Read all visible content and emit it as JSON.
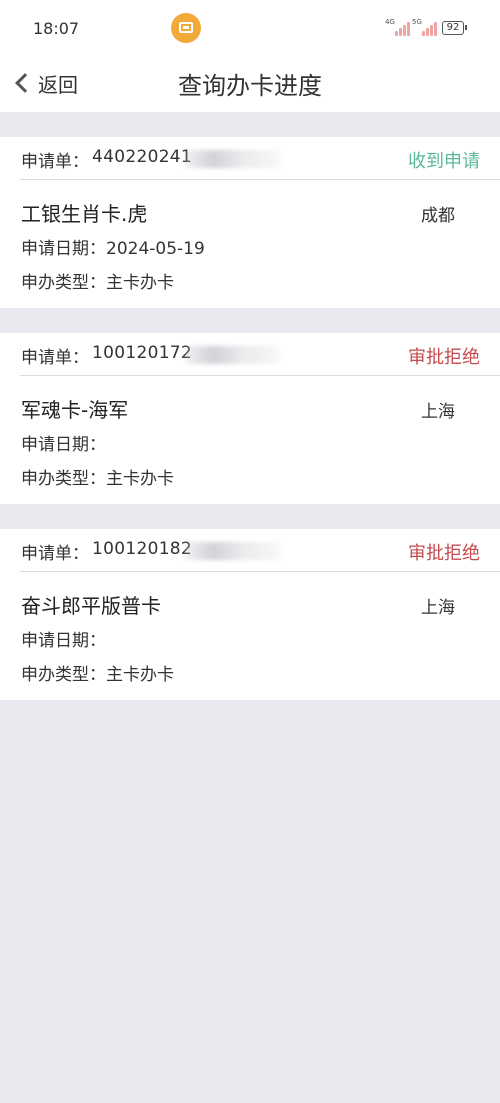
{
  "status_bar": {
    "time": "18:07",
    "signal_1": "4G",
    "signal_2": "5G",
    "battery": "92"
  },
  "nav": {
    "back_label": "返回",
    "title": "查询办卡进度"
  },
  "labels": {
    "application_no": "申请单：",
    "apply_date": "申请日期：",
    "apply_type": "申办类型："
  },
  "applications": [
    {
      "number": "440220241",
      "status": "收到申请",
      "status_kind": "accepted",
      "card_name": "工银生肖卡.虎",
      "city": "成都",
      "apply_date": "2024-05-19",
      "apply_type": "主卡办卡"
    },
    {
      "number": "100120172",
      "status": "审批拒绝",
      "status_kind": "rejected",
      "card_name": "军魂卡-海军",
      "city": "上海",
      "apply_date": "",
      "apply_type": "主卡办卡"
    },
    {
      "number": "100120182",
      "status": "审批拒绝",
      "status_kind": "rejected",
      "card_name": "奋斗郎平版普卡",
      "city": "上海",
      "apply_date": "",
      "apply_type": "主卡办卡"
    }
  ],
  "colors": {
    "accepted": "#5cb894",
    "rejected": "#c44c4f",
    "app_icon": "#f2a93a",
    "background": "#e9e9ef"
  }
}
